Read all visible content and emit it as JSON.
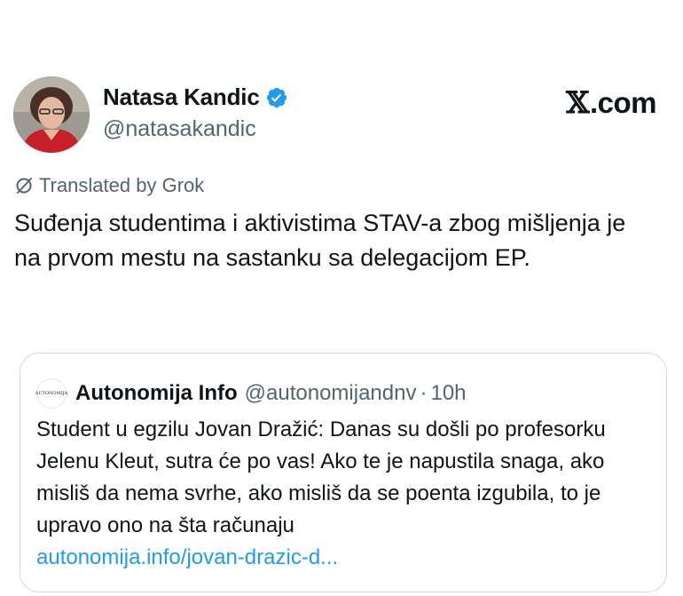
{
  "post": {
    "author": {
      "name": "Natasa Kandic",
      "handle": "@natasakandic",
      "verified": true,
      "avatar_icon": "profile-photo"
    },
    "site_logo": {
      "glyph": "𝕏",
      "text": ".com"
    },
    "translation_note": "Translated by Grok",
    "text": "Suđenja studentima i aktivistima STAV-a zbog mišljenja je na prvom mestu na sastanku sa delegacijom EP."
  },
  "quote": {
    "avatar_text": "AUTONOMIJA",
    "name": "Autonomija Info",
    "handle": "@autonomijandnv",
    "separator": "·",
    "time": "10h",
    "text": "Student u egzilu Jovan Dražić: Danas su došli po profesorku Jelenu Kleut, sutra će po vas! Ako te je napustila snaga, ako misliš da nema svrhe, ako misliš da se poenta izgubila, to je upravo ono na šta računaju",
    "link": "autonomija.info/jovan-drazic-d..."
  },
  "colors": {
    "text_primary": "#0f1419",
    "text_secondary": "#536471",
    "verified_badge": "#1d9bf0",
    "link": "#1d9bf0",
    "border": "#cfd9de"
  }
}
